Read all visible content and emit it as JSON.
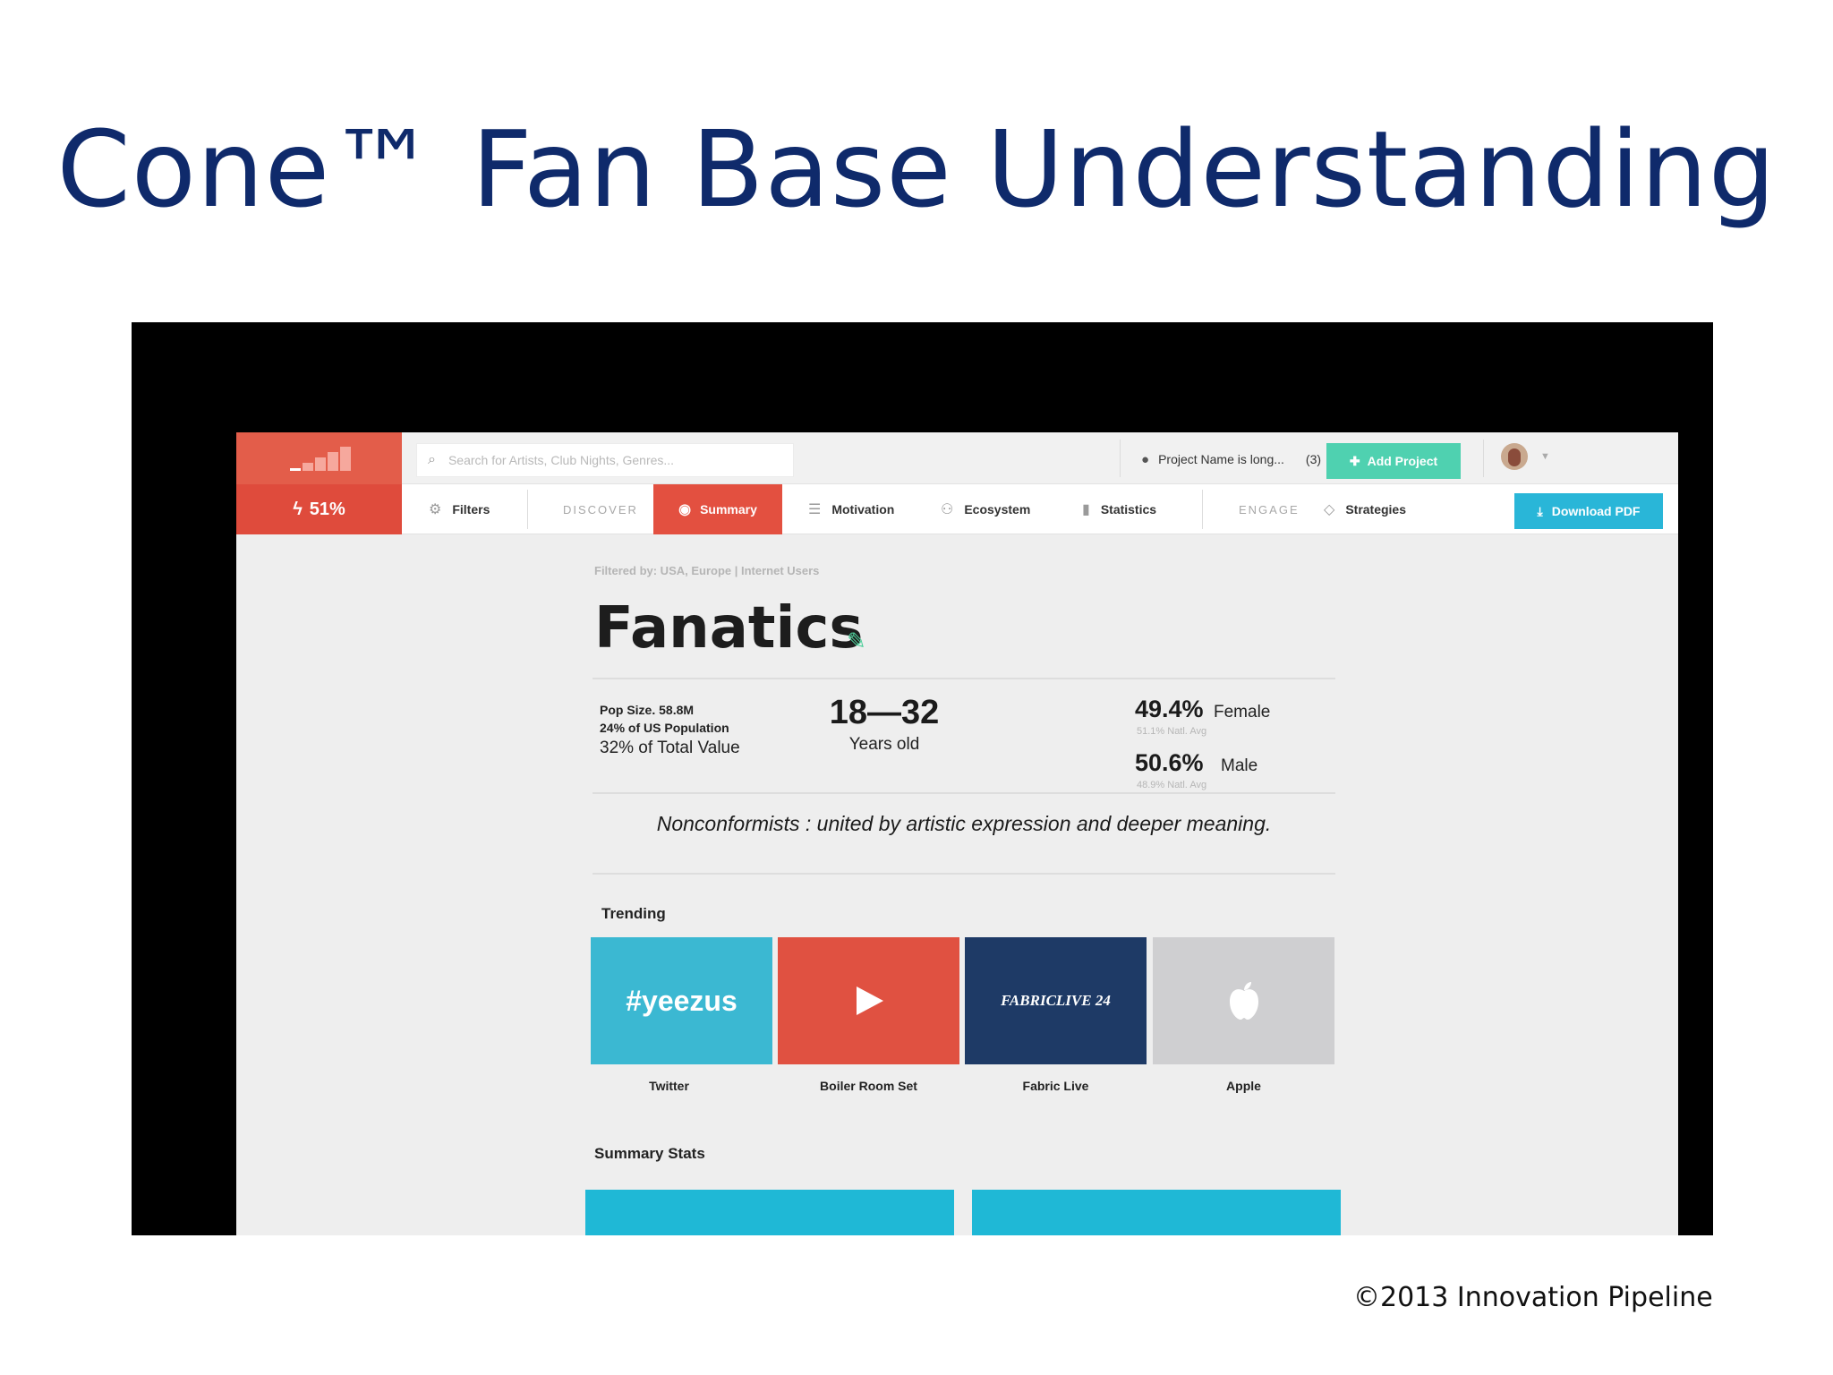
{
  "slide": {
    "title": "Cone™ Fan Base Understanding",
    "copyright": "©2013 Innovation Pipeline"
  },
  "app": {
    "brand": {
      "score": "51%"
    },
    "search": {
      "placeholder": "Search for Artists, Club Nights, Genres..."
    },
    "project": {
      "name": "Project Name is long...",
      "count": "(3)"
    },
    "add_project_label": "Add Project",
    "nav": {
      "filters": "Filters",
      "discover": "DISCOVER",
      "summary": "Summary",
      "motivation": "Motivation",
      "ecosystem": "Ecosystem",
      "statistics": "Statistics",
      "engage": "ENGAGE",
      "strategies": "Strategies",
      "download_pdf": "Download PDF"
    },
    "segment": {
      "filtered_by": "Filtered by: USA, Europe   |  Internet Users",
      "name": "Fanatics",
      "pop_size": "Pop Size. 58.8M",
      "pop_share": "24% of US Population",
      "total_value": "32% of Total Value",
      "age_range": "18—32",
      "age_label": "Years old",
      "female_pct": "49.4%",
      "female_label": "Female",
      "female_avg": "51.1% Natl. Avg",
      "male_pct": "50.6%",
      "male_label": "Male",
      "male_avg": "48.9% Natl. Avg",
      "tagline": "Nonconformists : united by artistic expression and deeper meaning."
    },
    "trending": {
      "heading": "Trending",
      "items": [
        {
          "label": "Twitter",
          "tile_text": "#yeezus",
          "color": "#3bb8d2"
        },
        {
          "label": "Boiler Room Set",
          "tile_text": "",
          "color": "#e05141"
        },
        {
          "label": "Fabric Live",
          "tile_text": "FABRICLIVE 24",
          "color": "#1e3a66"
        },
        {
          "label": "Apple",
          "tile_text": "",
          "color": "#cfcfd1"
        }
      ]
    },
    "summary_stats": {
      "heading": "Summary Stats"
    }
  },
  "colors": {
    "title_blue": "#0f2a6b",
    "brand_red": "#e35d4a",
    "accent_green": "#4fd1b0",
    "accent_blue": "#29b6d8"
  }
}
